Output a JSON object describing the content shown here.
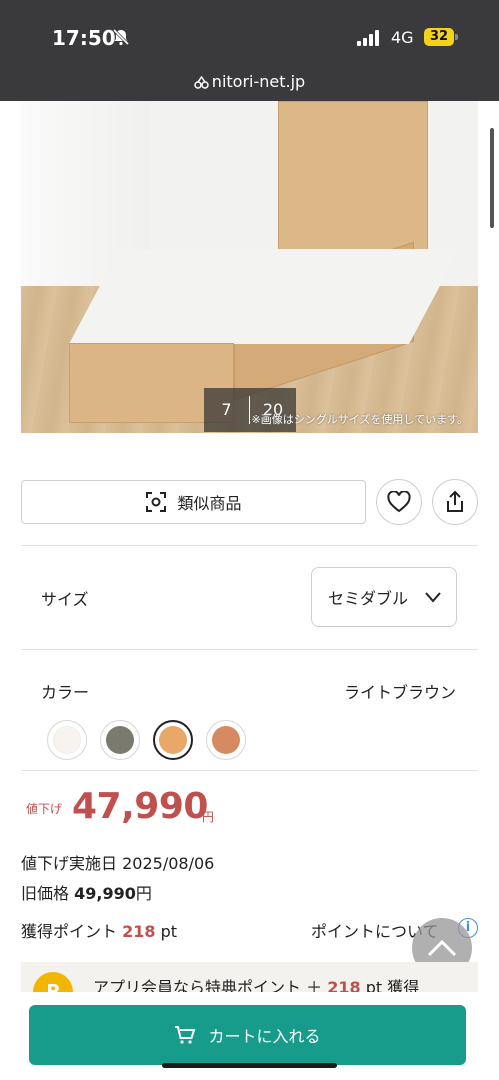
{
  "status_bar": {
    "time": "17:50",
    "network": "4G",
    "battery": "32"
  },
  "browser": {
    "url": "nitori-net.jp"
  },
  "gallery": {
    "current": "7",
    "total": "20",
    "caption": "※画像はシングルサイズを使用しています。"
  },
  "actions": {
    "similar_label": "類似商品",
    "similar_icon": "scan-icon",
    "favorite_icon": "heart-icon",
    "share_icon": "share-icon"
  },
  "size": {
    "label": "サイズ",
    "selected": "セミダブル"
  },
  "color": {
    "label": "カラー",
    "selected_name": "ライトブラウン",
    "swatches": [
      "#f7f3ef",
      "#7a7a6e",
      "#e7a868",
      "#d58a62"
    ],
    "selected_index": 2
  },
  "price": {
    "badge": "値下げ",
    "amount": "47,990",
    "unit": "円",
    "reduced_date_label": "値下げ実施日",
    "reduced_date": "2025/08/06",
    "old_price_label": "旧価格",
    "old_price": "49,990",
    "old_price_unit": "円",
    "accent_color": "#c0504d"
  },
  "points": {
    "label": "獲得ポイント",
    "value": "218",
    "unit": "pt",
    "about_label": "ポイントについて",
    "info_icon": "i"
  },
  "app_banner": {
    "coin": "P",
    "text_before": "アプリ会員なら特典ポイント ＋",
    "points": "218",
    "text_after": "pt 獲得"
  },
  "cart": {
    "label": "カートに入れる",
    "icon": "cart-icon",
    "color": "#179c8c"
  }
}
